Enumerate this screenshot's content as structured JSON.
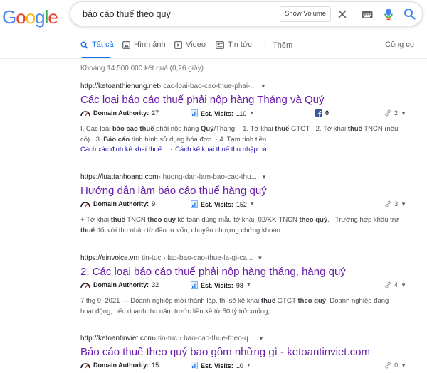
{
  "logo": "Google",
  "search": {
    "query": "báo cáo thuế theo quý",
    "show_volume": "Show Volume"
  },
  "tabs": [
    {
      "label": "Tất cả"
    },
    {
      "label": "Hình ảnh"
    },
    {
      "label": "Video"
    },
    {
      "label": "Tin tức"
    },
    {
      "label": "Thêm"
    }
  ],
  "tools_label": "Công cụ",
  "stats": "Khoảng 14.500.000 kết quả (0,26 giây)",
  "seo_labels": {
    "da": "Domain Authority:",
    "ev": "Est. Visits:"
  },
  "results": [
    {
      "site": "http://ketoanthienung.net",
      "path": " › cac-loai-bao-cao-thue-phai-...",
      "title": "Các loại báo cáo thuế phải nộp hàng Tháng và Quý",
      "da": "27",
      "ev": "110",
      "fb": "0",
      "links": "2",
      "snippet": [
        {
          "t": "I. Các loại ",
          "b": false
        },
        {
          "t": "báo cáo thuế",
          "b": true
        },
        {
          "t": " phải nộp hàng ",
          "b": false
        },
        {
          "t": "Quý",
          "b": true
        },
        {
          "t": "/Tháng: · 1. Tờ khai ",
          "b": false
        },
        {
          "t": "thuế",
          "b": true
        },
        {
          "t": " GTGT · 2. Tờ khai ",
          "b": false
        },
        {
          "t": "thuế",
          "b": true
        },
        {
          "t": " TNCN (nếu có) · 3. ",
          "b": false
        },
        {
          "t": "Báo cáo",
          "b": true
        },
        {
          "t": " tình hình sử dụng hóa đơn. · 4. Tạm tính tiền ...",
          "b": false
        }
      ],
      "sitelinks": [
        "Cách xác định kê khai thuế...",
        "Cách kê khai thuế thu nhập cá..."
      ]
    },
    {
      "site": "https://luattanhoang.com",
      "path": " › huong-dan-lam-bao-cao-thu...",
      "title": "Hướng dẫn làm báo cáo thuế hàng quý",
      "da": "9",
      "ev": "152",
      "links": "3",
      "snippet": [
        {
          "t": "+ Tờ khai ",
          "b": false
        },
        {
          "t": "thuế",
          "b": true
        },
        {
          "t": " TNCN ",
          "b": false
        },
        {
          "t": "theo quý",
          "b": true
        },
        {
          "t": " kê toán dùng mẫu tờ khai: 02/KK-TNCN ",
          "b": false
        },
        {
          "t": "theo quý",
          "b": true
        },
        {
          "t": ". - Trường hợp khấu trừ ",
          "b": false
        },
        {
          "t": "thuế",
          "b": true
        },
        {
          "t": " đối với thu nhập từ đầu tư vốn, chuyển nhượng chứng khoán ...",
          "b": false
        }
      ]
    },
    {
      "site": "https://einvoice.vn",
      "path": " › tin-tuc › lap-bao-cao-thue-la-gi-ca...",
      "title": "2. Các loại báo cáo thuế phải nộp hàng tháng, hàng quý",
      "da": "32",
      "ev": "98",
      "links": "4",
      "snippet": [
        {
          "t": "7 thg 9, 2021 — Doanh nghiệp mới thành lập, thì sẽ kê khai ",
          "b": false
        },
        {
          "t": "thuế",
          "b": true
        },
        {
          "t": " GTGT ",
          "b": false
        },
        {
          "t": "theo quý",
          "b": true
        },
        {
          "t": ". Doanh nghiệp đang hoạt động, nếu doanh thu năm trước liền kề từ 50 tỷ trở xuống, ...",
          "b": false
        }
      ]
    },
    {
      "site": "http://ketoantinviet.com",
      "path": " › tin-tuc › bao-cao-thue-theo-q...",
      "title": "Báo cáo thuế theo quý bao gồm những gì - ketoantinviet.com",
      "da": "15",
      "ev": "10",
      "links": "0"
    }
  ],
  "colors": {
    "link_visited": "#681da8",
    "link": "#1a0dab",
    "accent": "#1a73e8"
  }
}
